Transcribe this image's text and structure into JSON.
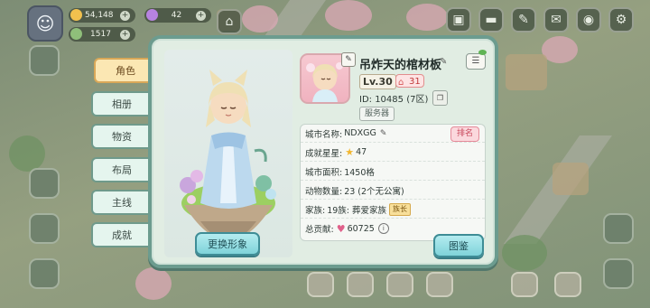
{
  "hud": {
    "coins": "54,148",
    "gems": "42",
    "energy": "1517"
  },
  "tabs": [
    {
      "label": "角色",
      "active": true
    },
    {
      "label": "相册",
      "active": false
    },
    {
      "label": "物资",
      "active": false
    },
    {
      "label": "布局",
      "active": false
    },
    {
      "label": "主线",
      "active": false
    },
    {
      "label": "成就",
      "active": false
    }
  ],
  "profile": {
    "name": "吊炸天的棺材板",
    "level": "Lv.30",
    "badge_count": "31",
    "uid": "ID: 10485 (7区)",
    "server_label": "服务器",
    "change_look_label": "更换形象",
    "collection_label": "图鉴"
  },
  "stats": {
    "city_name_label": "城市名称:",
    "city_name": "NDXGG",
    "rank_label": "排名",
    "stars_label": "成就星星:",
    "stars": "47",
    "area_label": "城市面积:",
    "area": "1450格",
    "animals_label": "动物数量:",
    "animals": "23 (2个无公寓)",
    "family_label": "家族:",
    "family": "19族: 葬爱家族",
    "family_role": "族长",
    "contribution_label": "总贡献:",
    "contribution": "60725"
  },
  "colors": {
    "accent": "#6c9c8f",
    "active_tab": "#fbe7b3",
    "button": "#7fd3da",
    "rank": "#c8485c"
  }
}
